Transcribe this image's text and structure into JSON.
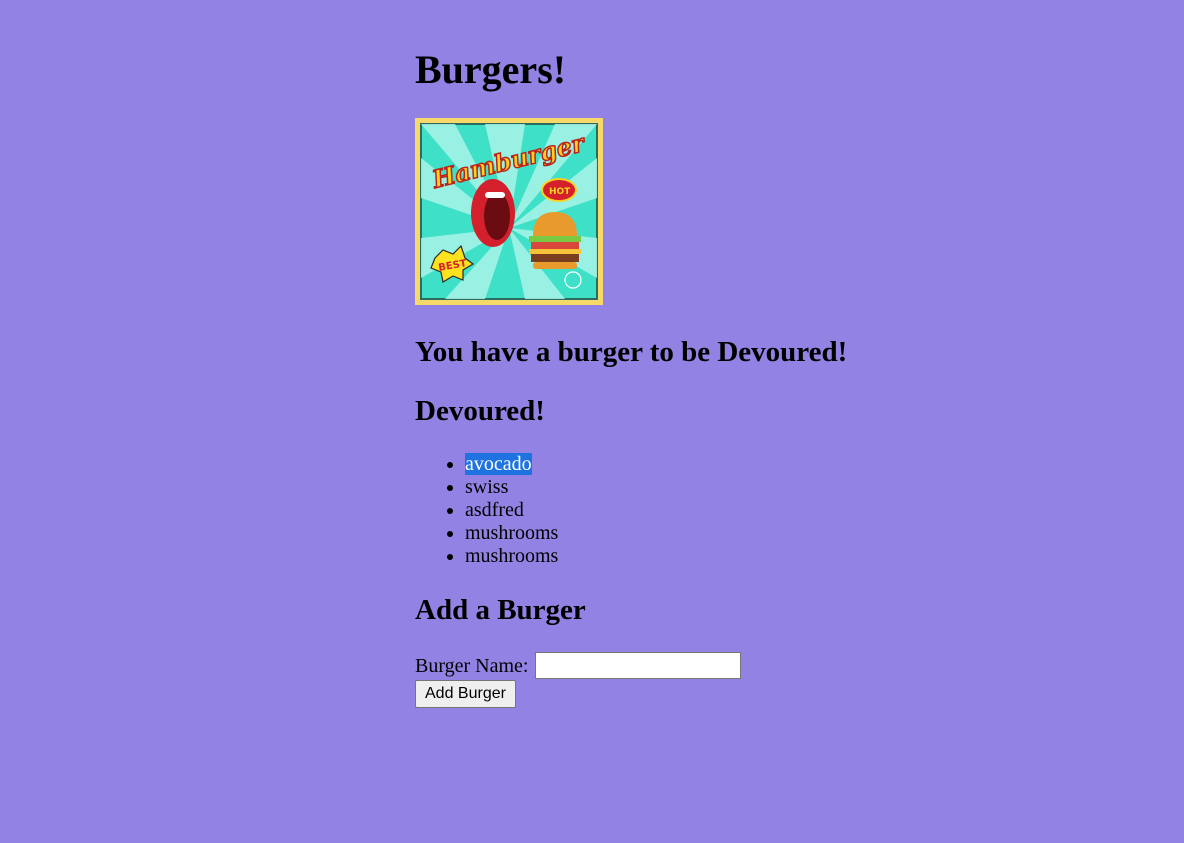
{
  "page": {
    "title": "Burgers!"
  },
  "logo": {
    "text_lettering": "Hamburger",
    "badge_hot": "HOT",
    "badge_best": "BEST",
    "colors": {
      "frame": "#f7d96a",
      "background": "#3fe0c8",
      "rays": "#a9f5e8",
      "lips": "#d4202c",
      "bun": "#e89a2c"
    }
  },
  "to_devour": {
    "heading": "You have a burger to be Devoured!"
  },
  "devoured": {
    "heading": "Devoured!",
    "items": [
      {
        "label": "avocado",
        "selected": true
      },
      {
        "label": "swiss"
      },
      {
        "label": "asdfred"
      },
      {
        "label": "mushrooms"
      },
      {
        "label": "mushrooms"
      }
    ]
  },
  "add_form": {
    "heading": "Add a Burger",
    "name_label": "Burger Name:",
    "name_value": "",
    "name_placeholder": "",
    "submit_label": "Add Burger"
  },
  "theme": {
    "page_background": "#9282e4",
    "selection_color": "#1e73e0"
  }
}
